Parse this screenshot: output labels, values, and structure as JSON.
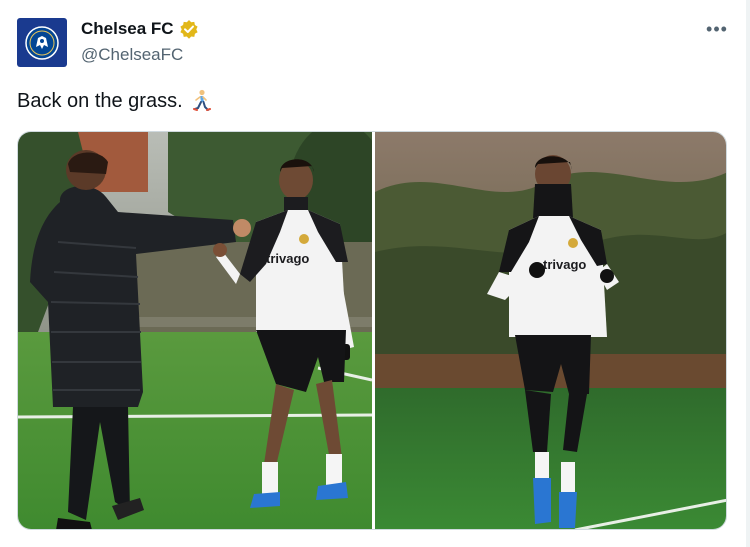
{
  "account": {
    "display_name": "Chelsea FC",
    "handle": "@ChelseaFC",
    "verified": "verified-gold-badge-icon",
    "avatar": "chelsea-crest-icon"
  },
  "menu": {
    "more_label": "•••"
  },
  "tweet": {
    "text": "Back on the grass.",
    "emoji": "runner-emoji-icon"
  },
  "media": {
    "photos": [
      {
        "kit_sponsor": "trivago",
        "scene": "fist-bump-training"
      },
      {
        "kit_sponsor": "trivago",
        "scene": "running-training"
      }
    ]
  },
  "colors": {
    "brand": "#034694",
    "verified_gold": "#e2b719",
    "pitch": "#4d9a3a",
    "text_primary": "#0f1419",
    "text_secondary": "#536471"
  }
}
